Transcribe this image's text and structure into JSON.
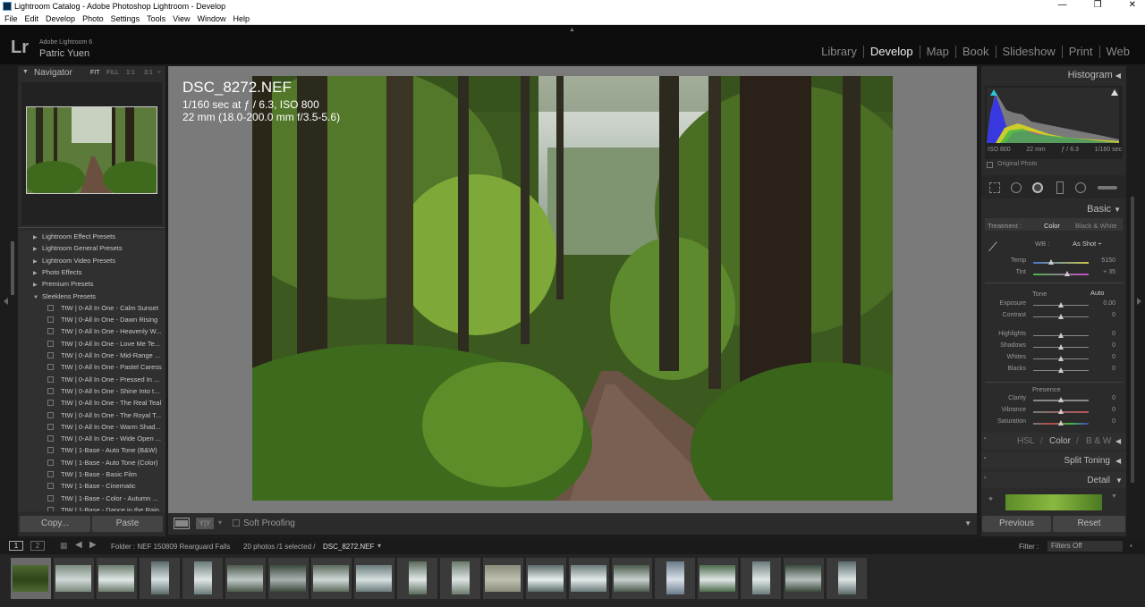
{
  "window": {
    "title": "Lightroom Catalog - Adobe Photoshop Lightroom - Develop",
    "controls": [
      "—",
      "❐",
      "✕"
    ]
  },
  "menu": [
    "File",
    "Edit",
    "Develop",
    "Photo",
    "Settings",
    "Tools",
    "View",
    "Window",
    "Help"
  ],
  "identity": {
    "logo": "Lr",
    "product": "Adobe Lightroom 6",
    "user": "Patric Yuen"
  },
  "modules": [
    "Library",
    "Develop",
    "Map",
    "Book",
    "Slideshow",
    "Print",
    "Web"
  ],
  "active_module": "Develop",
  "navigator": {
    "title": "Navigator",
    "zoom_options": [
      "FIT",
      "FILL",
      "1:1",
      "3:1"
    ]
  },
  "presets": {
    "folders": [
      "Lightroom Effect Presets",
      "Lightroom General Presets",
      "Lightroom Video Presets",
      "Photo Effects",
      "Premium Presets",
      "Sleeklens Presets"
    ],
    "items": [
      "TtW | 0-All In One - Calm Sunset",
      "TtW | 0-All In One - Dawn Rising",
      "TtW | 0-All In One - Heavenly W...",
      "TtW | 0-All In One - Love Me Te...",
      "TtW | 0-All In One - Mid-Range ...",
      "TtW | 0-All In One - Pastel Caress",
      "TtW | 0-All In One - Pressed In ...",
      "TtW | 0-All In One - Shine Into t...",
      "TtW | 0-All In One - The Real Teal",
      "TtW | 0-All In One - The Royal T...",
      "TtW | 0-All In One - Warm Shad...",
      "TtW | 0-All In One - Wide Open ...",
      "TtW | 1-Base - Auto Tone (B&W)",
      "TtW | 1-Base - Auto Tone (Color)",
      "TtW | 1-Base - Basic Film",
      "TtW | 1-Base - Cinematic",
      "TtW | 1-Base - Color - Autumn ...",
      "TtW | 1-Base - Dance in the Rain"
    ]
  },
  "left_buttons": {
    "copy": "Copy...",
    "paste": "Paste"
  },
  "photo": {
    "filename": "DSC_8272.NEF",
    "exposure": "1/160 sec at ƒ / 6.3, ISO 800",
    "lens": "22 mm (18.0-200.0 mm f/3.5-5.6)"
  },
  "toolbar": {
    "soft_proofing": "Soft Proofing",
    "before_after": "Y|Y"
  },
  "histogram": {
    "title": "Histogram",
    "info": [
      "ISO 800",
      "22 mm",
      "ƒ / 6.3",
      "1/160 sec"
    ],
    "original_photo": "Original Photo"
  },
  "basic": {
    "title": "Basic",
    "treatment_label": "Treatment :",
    "treatment_color": "Color",
    "treatment_bw": "Black & White",
    "wb_label": "WB :",
    "wb_value": "As Shot ÷",
    "tone_label": "Tone",
    "auto_label": "Auto",
    "presence_label": "Presence",
    "sliders": [
      {
        "label": "Temp",
        "value": "5150",
        "pos": 0.33
      },
      {
        "label": "Tint",
        "value": "+ 35",
        "pos": 0.62
      },
      {
        "label": "Exposure",
        "value": "0.00",
        "pos": 0.5
      },
      {
        "label": "Contrast",
        "value": "0",
        "pos": 0.5
      },
      {
        "label": "Highlights",
        "value": "0",
        "pos": 0.5
      },
      {
        "label": "Shadows",
        "value": "0",
        "pos": 0.5
      },
      {
        "label": "Whites",
        "value": "0",
        "pos": 0.5
      },
      {
        "label": "Blacks",
        "value": "0",
        "pos": 0.5
      },
      {
        "label": "Clarity",
        "value": "0",
        "pos": 0.5
      },
      {
        "label": "Vibrance",
        "value": "0",
        "pos": 0.5
      },
      {
        "label": "Saturation",
        "value": "0",
        "pos": 0.5
      }
    ]
  },
  "hsl": {
    "hsl": "HSL",
    "color": "Color",
    "bw": "B & W",
    "sep": "/"
  },
  "split_toning": "Split Toning",
  "detail": "Detail",
  "right_buttons": {
    "previous": "Previous",
    "reset": "Reset"
  },
  "bottom": {
    "views": [
      "1",
      "2"
    ],
    "folder": "Folder : NEF 150809 Rearguard Falls",
    "count": "20 photos /1 selected /",
    "selected": "DSC_8272.NEF",
    "filter_label": "Filter :",
    "filter_value": "Filters Off"
  },
  "filmstrip_count": 20
}
